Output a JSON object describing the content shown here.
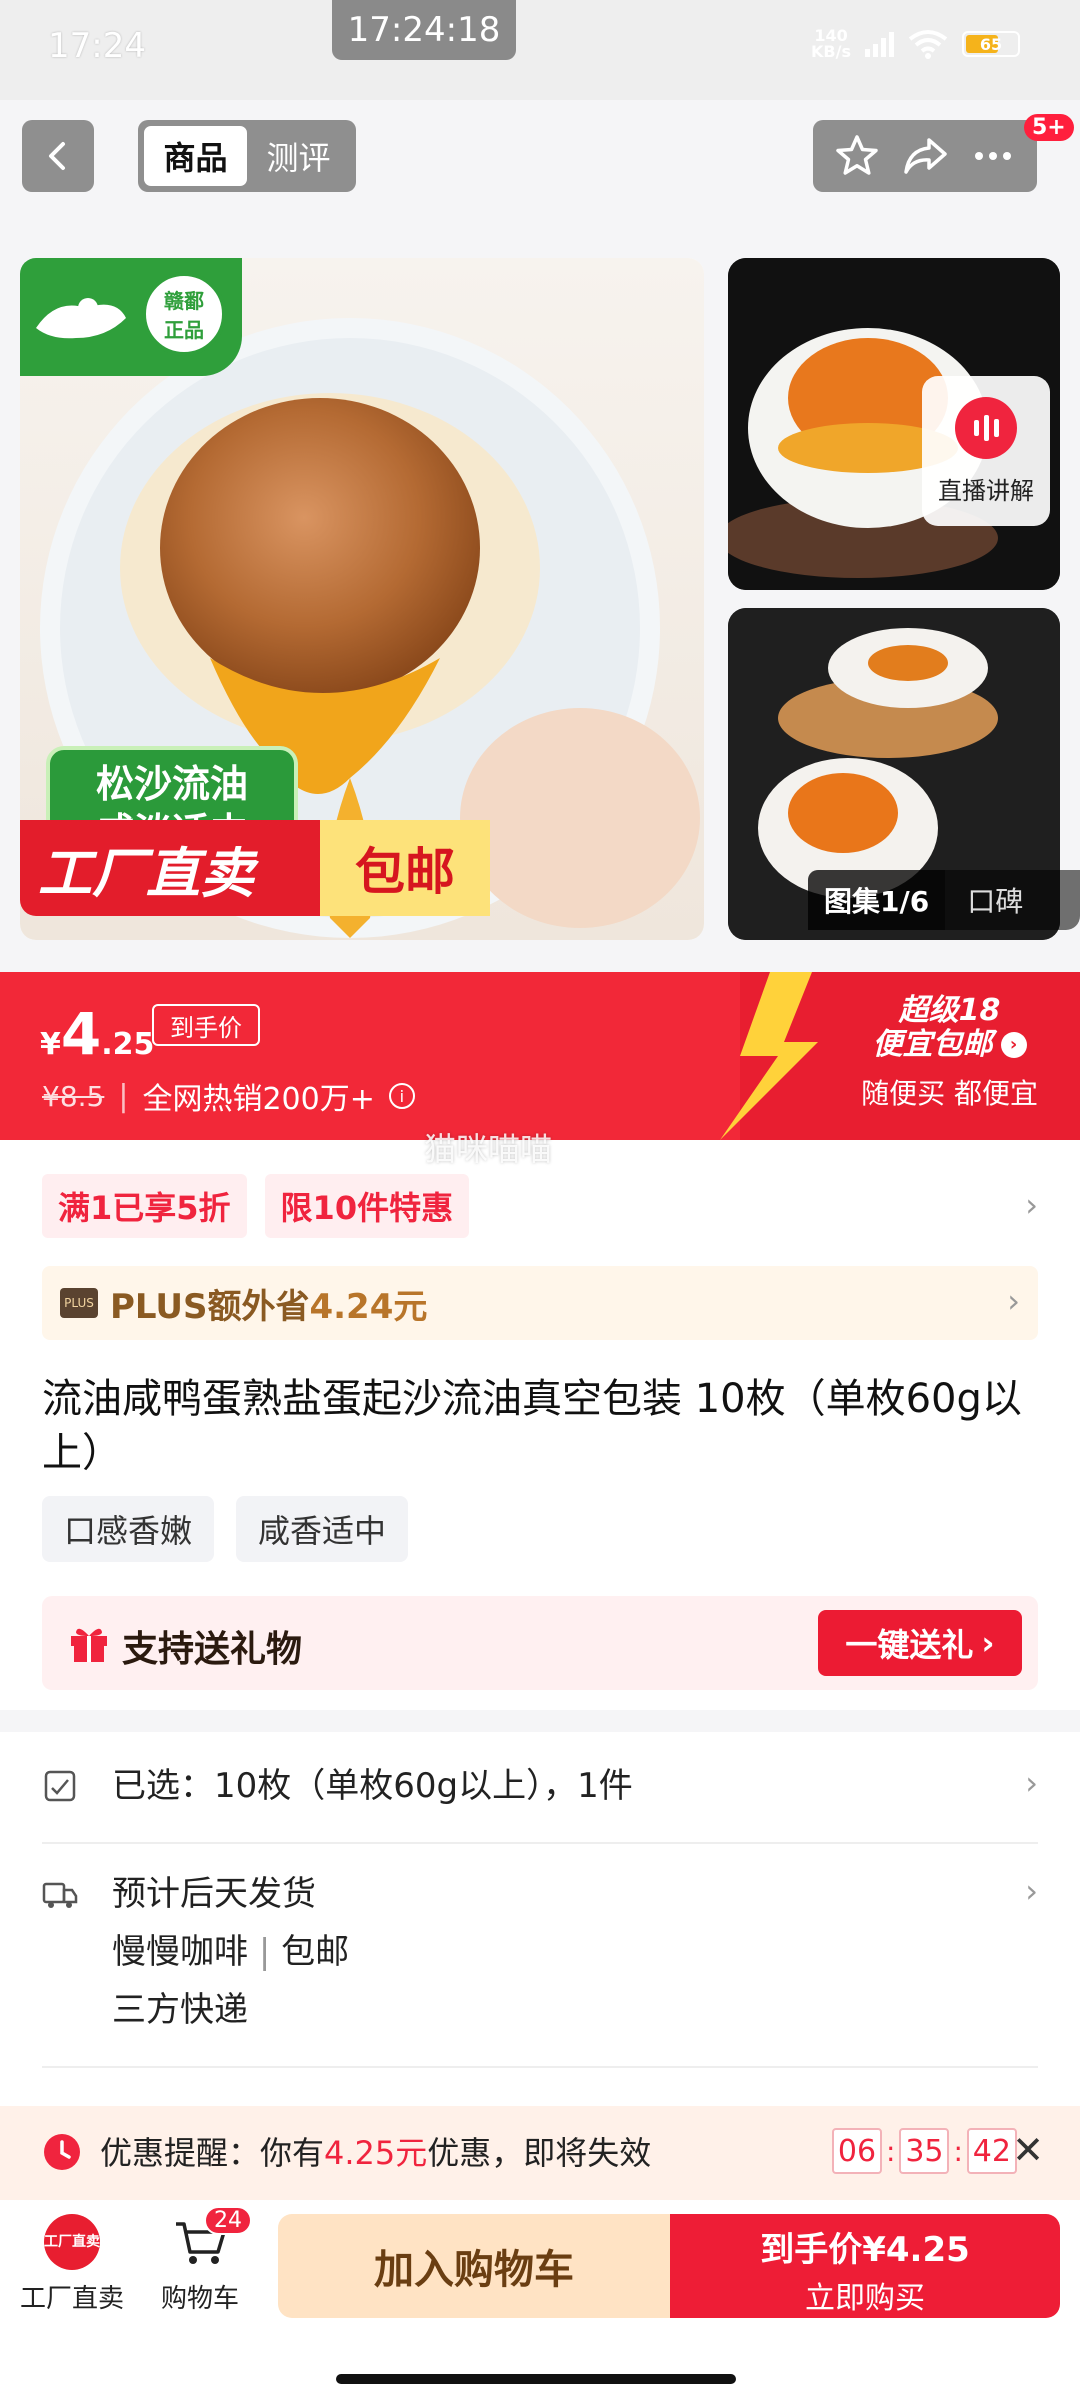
{
  "status_bar": {
    "time": "17:24",
    "clock_pill": "17:24:18",
    "net_speed_value": "140",
    "net_speed_unit": "KB/s",
    "battery": "65"
  },
  "top_nav": {
    "tabs": [
      {
        "label": "商品",
        "active": true
      },
      {
        "label": "测评",
        "active": false
      }
    ],
    "badge": "5+"
  },
  "gallery": {
    "main_badge_brand": "赣鄱",
    "main_badge_sub": "正品",
    "main_slogan_1": "松沙流油",
    "main_slogan_2": "咸淡适中",
    "main_banner_left": "工厂直卖",
    "main_banner_right": "包邮",
    "live_label": "直播讲解",
    "album_label": "图集1/6",
    "reviews_label": "口碑"
  },
  "price": {
    "currency": "¥",
    "integer": "4",
    "decimal": ".25",
    "tag": "到手价",
    "original": "¥8.5",
    "sales": "全网热销200万+",
    "promo_line1": "超级18",
    "promo_line2": "便宜包邮",
    "promo_sub": "随便买 都便宜"
  },
  "watermark": "猫咪喵喵",
  "coupons": [
    "满1已享5折",
    "限10件特惠"
  ],
  "plus": {
    "logo": "PLUS",
    "text": "PLUS额外省",
    "amount": "4.24元"
  },
  "product_title": "流油咸鸭蛋熟盐蛋起沙流油真空包装 10枚（单枚60g以上）",
  "feature_tags": [
    "口感香嫩",
    "咸香适中"
  ],
  "gift": {
    "label": "支持送礼物",
    "button": "一键送礼"
  },
  "spec": {
    "selected": "已选：10枚（单枚60g以上），1件",
    "shipping_title": "预计后天发货",
    "shop": "慢慢咖啡",
    "shop_sep": "|",
    "shipping_free": "包邮",
    "courier": "三方快递"
  },
  "reminder": {
    "prefix": "优惠提醒：你有",
    "amount": "4.25元",
    "suffix": "优惠，即将失效",
    "hours": "06",
    "minutes": "35",
    "seconds": "42"
  },
  "bottom_bar": {
    "factory_icon_text": "工厂直卖",
    "factory_label": "工厂直卖",
    "cart_label": "购物车",
    "cart_count": "24",
    "add_cart": "加入购物车",
    "buy_line1": "到手价",
    "buy_price": "¥4.25",
    "buy_line2": "立即购买"
  },
  "colors": {
    "brand_red": "#f22838",
    "accent_red": "#ee1d36",
    "plus_gold": "#8a5a22",
    "add_cart_bg": "#ffe3c4"
  }
}
